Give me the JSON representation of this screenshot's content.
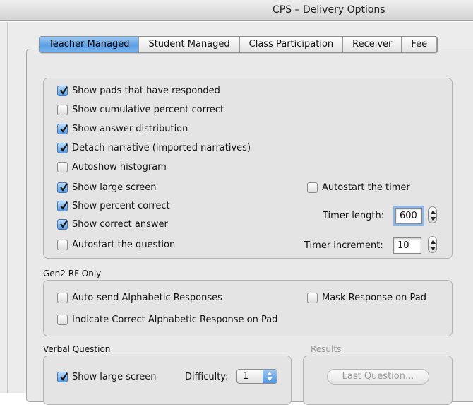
{
  "window": {
    "title": "CPS – Delivery Options"
  },
  "tabs": [
    {
      "label": "Teacher Managed",
      "active": true
    },
    {
      "label": "Student Managed",
      "active": false
    },
    {
      "label": "Class Participation",
      "active": false
    },
    {
      "label": "Receiver",
      "active": false
    },
    {
      "label": "Fee",
      "active": false
    }
  ],
  "display_options": [
    {
      "label": "Show pads that have responded",
      "checked": true
    },
    {
      "label": "Show cumulative percent correct",
      "checked": false
    },
    {
      "label": "Show answer distribution",
      "checked": true
    },
    {
      "label": "Detach narrative (imported narratives)",
      "checked": true
    },
    {
      "label": "Autoshow histogram",
      "checked": false
    },
    {
      "label": "Show large screen",
      "checked": true
    },
    {
      "label": "Show percent correct",
      "checked": true
    },
    {
      "label": "Show correct answer",
      "checked": true
    },
    {
      "label": "Autostart the question",
      "checked": false
    }
  ],
  "timer": {
    "autostart_label": "Autostart the timer",
    "autostart_checked": false,
    "length_label": "Timer length:",
    "length_value": "600",
    "increment_label": "Timer increment:",
    "increment_value": "10"
  },
  "gen2": {
    "title": "Gen2 RF Only",
    "auto_send": {
      "label": "Auto-send Alphabetic Responses",
      "checked": false
    },
    "mask_response": {
      "label": "Mask Response on Pad",
      "checked": false
    },
    "indicate_correct": {
      "label": "Indicate Correct Alphabetic Response on Pad",
      "checked": false
    }
  },
  "verbal": {
    "title": "Verbal Question",
    "show_large_screen": {
      "label": "Show large screen",
      "checked": true
    },
    "difficulty_label": "Difficulty:",
    "difficulty_value": "1"
  },
  "results": {
    "title": "Results",
    "last_question_label": "Last Question..."
  },
  "colors": {
    "tab_active": "#5c9fe4",
    "checkbox_checked": "#5a9de3",
    "window_bg": "#ececec"
  }
}
